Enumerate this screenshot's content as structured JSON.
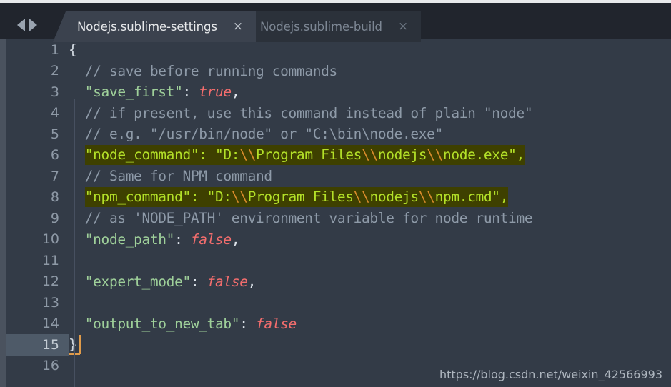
{
  "window": {
    "app": "Sublime Text",
    "accent_highlight": "#3e4000",
    "accent_highlight_text": "#b3e028",
    "cursor_color": "#e09b4a",
    "background": "#333b47"
  },
  "tabbar": {
    "nav_back_icon": "arrow-left-icon",
    "nav_forward_icon": "arrow-right-icon",
    "tabs": [
      {
        "label": "Nodejs.sublime-settings",
        "close": "×",
        "active": true
      },
      {
        "label": "Nodejs.sublime-build",
        "close": "×",
        "active": false
      }
    ]
  },
  "editor": {
    "active_line": 15,
    "line_numbers": [
      "1",
      "2",
      "3",
      "4",
      "5",
      "6",
      "7",
      "8",
      "9",
      "10",
      "11",
      "12",
      "13",
      "14",
      "15",
      "16"
    ],
    "lines": [
      {
        "n": "1",
        "text": "{"
      },
      {
        "n": "2",
        "text": "  // save before running commands"
      },
      {
        "n": "3",
        "text": "  \"save_first\": true,"
      },
      {
        "n": "4",
        "text": "  // if present, use this command instead of plain \"node\""
      },
      {
        "n": "5",
        "text": "  // e.g. \"/usr/bin/node\" or \"C:\\bin\\node.exe\""
      },
      {
        "n": "6",
        "text": "  \"node_command\": \"D:\\\\Program Files\\\\nodejs\\\\node.exe\","
      },
      {
        "n": "7",
        "text": "  // Same for NPM command"
      },
      {
        "n": "8",
        "text": "  \"npm_command\": \"D:\\\\Program Files\\\\nodejs\\\\npm.cmd\","
      },
      {
        "n": "9",
        "text": "  // as 'NODE_PATH' environment variable for node runtime"
      },
      {
        "n": "10",
        "text": "  \"node_path\": false,"
      },
      {
        "n": "11",
        "text": ""
      },
      {
        "n": "12",
        "text": "  \"expert_mode\": false,"
      },
      {
        "n": "13",
        "text": ""
      },
      {
        "n": "14",
        "text": "  \"output_to_new_tab\": false"
      },
      {
        "n": "15",
        "text": "}"
      },
      {
        "n": "16",
        "text": ""
      }
    ],
    "tokens": {
      "l1_brace": "{",
      "l2_comment": "// save before running commands",
      "l3_key": "\"save_first\"",
      "l3_colon": ": ",
      "l3_bool": "true",
      "l3_comma": ",",
      "l4_comment": "// if present, use this command instead of plain \"node\"",
      "l5_comment": "// e.g. \"/usr/bin/node\" or \"C:\\bin\\node.exe\"",
      "l6_a": "\"node_command\": \"D:",
      "l6_e1": "\\\\",
      "l6_b": "Program Files",
      "l6_e2": "\\\\",
      "l6_c": "nodejs",
      "l6_e3": "\\\\",
      "l6_d": "node.exe\",",
      "l7_comment": "// Same for NPM command",
      "l8_a": "\"npm_command\": \"D:",
      "l8_e1": "\\\\",
      "l8_b": "Program Files",
      "l8_e2": "\\\\",
      "l8_c": "nodejs",
      "l8_e3": "\\\\",
      "l8_d": "npm.cmd\",",
      "l9_comment": "// as 'NODE_PATH' environment variable for node runtime",
      "l10_key": "\"node_path\"",
      "l10_colon": ": ",
      "l10_bool": "false",
      "l10_comma": ",",
      "l12_key": "\"expert_mode\"",
      "l12_colon": ": ",
      "l12_bool": "false",
      "l12_comma": ",",
      "l14_key": "\"output_to_new_tab\"",
      "l14_colon": ": ",
      "l14_bool": "false",
      "l15_brace": "}"
    }
  },
  "watermark": {
    "text": "https://blog.csdn.net/weixin_42566993"
  }
}
